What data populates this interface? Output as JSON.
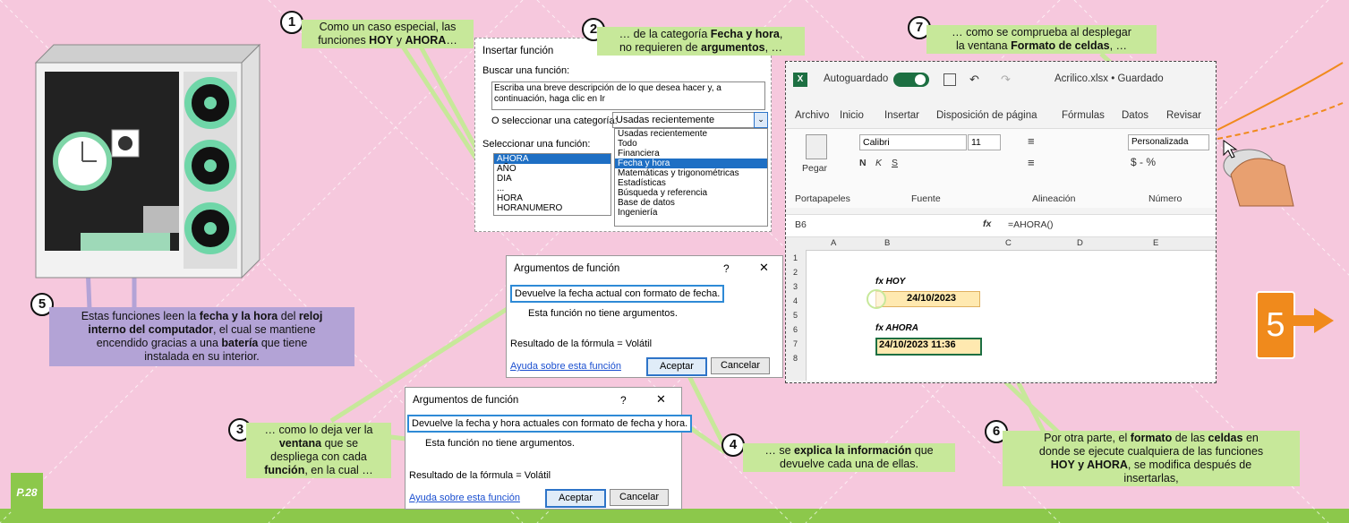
{
  "callouts": {
    "c1_a": "Como un caso especial, las",
    "c1_b_pre": "funciones ",
    "c1_b_bold1": "HOY",
    "c1_b_mid": " y ",
    "c1_b_bold2": "AHORA",
    "c1_b_post": "…",
    "c2_a_pre": "… de la categoría ",
    "c2_a_bold": "Fecha y hora",
    "c2_a_post": ",",
    "c2_b_pre": "no requieren de ",
    "c2_b_bold": "argumentos",
    "c2_b_post": ", …",
    "c3_a": "… como lo deja ver la",
    "c3_b": "ventana",
    "c3_b_post": " que se",
    "c3_c": "despliega con cada",
    "c3_d_bold": "función",
    "c3_d_post": ", en la cual …",
    "c4_a_pre": "… se ",
    "c4_a_bold": "explica la información",
    "c4_a_post": " que",
    "c4_b": "devuelve cada una de ellas.",
    "c5_a_pre": "Estas funciones leen la ",
    "c5_a_bold": "fecha y la hora",
    "c5_a_mid": " del ",
    "c5_a_bold2": "reloj",
    "c5_b_bold": "interno del computador",
    "c5_b_post": ", el cual se mantiene",
    "c5_c_pre": "encendido gracias a una ",
    "c5_c_bold": "batería",
    "c5_c_post": " que tiene",
    "c5_d": "instalada en su interior.",
    "c6_a_pre": "Por otra parte, el ",
    "c6_a_bold": "formato",
    "c6_a_mid": " de las ",
    "c6_a_bold2": "celdas",
    "c6_a_post": " en",
    "c6_b": "donde se ejecute cualquiera de las funciones",
    "c6_c_bold": "HOY y AHORA",
    "c6_c_post": ", se modifica después de",
    "c6_d": "insertarlas,",
    "c7_a": "… como se comprueba al desplegar",
    "c7_b_pre": "la ventana ",
    "c7_b_bold": "Formato de celdas",
    "c7_b_post": ", …"
  },
  "numbers": [
    "1",
    "2",
    "3",
    "4",
    "5",
    "6",
    "7"
  ],
  "insert_dialog": {
    "title": "Insertar función",
    "search_label": "Buscar una función:",
    "search_text": "Escriba una breve descripción de lo que desea hacer y, a continuación, haga clic en Ir",
    "category_label": "O seleccionar una categoría:",
    "category_value": "Usadas recientemente",
    "function_label": "Seleccionar una función:",
    "functions": [
      "AHORA",
      "AÑO",
      "DIA",
      "...",
      "HORA",
      "HORANUMERO"
    ],
    "categories": [
      "Usadas recientemente",
      "Todo",
      "Financiera",
      "Fecha y hora",
      "Matemáticas y trigonométricas",
      "Estadísticas",
      "Búsqueda y referencia",
      "Base de datos",
      "Ingeniería"
    ]
  },
  "args_dialog_1": {
    "title": "Argumentos de función",
    "help": "?",
    "description": "Devuelve la fecha actual con formato de fecha.",
    "no_args": "Esta función no tiene argumentos.",
    "result": "Resultado de la fórmula = Volátil",
    "link": "Ayuda sobre esta función",
    "ok": "Aceptar",
    "cancel": "Cancelar"
  },
  "args_dialog_2": {
    "title": "Argumentos de función",
    "help": "?",
    "description": "Devuelve la fecha y hora actuales con formato de fecha y hora.",
    "no_args": "Esta función no tiene argumentos.",
    "result": "Resultado de la fórmula = Volátil",
    "link": "Ayuda sobre esta función",
    "ok": "Aceptar",
    "cancel": "Cancelar"
  },
  "excel": {
    "autosave": "Autoguardado",
    "filename": "Acrilico.xlsx • Guardado",
    "tabs": [
      "Archivo",
      "Inicio",
      "Insertar",
      "Disposición de página",
      "Fórmulas",
      "Datos",
      "Revisar"
    ],
    "font": "Calibri",
    "font_size": "11",
    "number_format": "Personalizada",
    "paste": "Pegar",
    "groups": [
      "Portapapeles",
      "Fuente",
      "Alineación",
      "Número"
    ],
    "cell_ref": "B6",
    "fx": "fx",
    "formula": "=AHORA()",
    "columns": [
      "A",
      "B",
      "C",
      "D",
      "E"
    ],
    "rows": [
      "1",
      "2",
      "3",
      "4",
      "5",
      "6",
      "7",
      "8"
    ],
    "label_hoy": "fx HOY",
    "value_hoy": "24/10/2023",
    "label_ahora": "fx AHORA",
    "value_ahora": "24/10/2023 11:36"
  },
  "page": {
    "badge": "5",
    "page_num": "P.28"
  },
  "colors": {
    "background": "#f6c8dd",
    "callout_green": "#c7e89a",
    "callout_purple": "#b3a3d6",
    "bottom_band": "#8cc84b",
    "accent_orange": "#f08a1c"
  }
}
